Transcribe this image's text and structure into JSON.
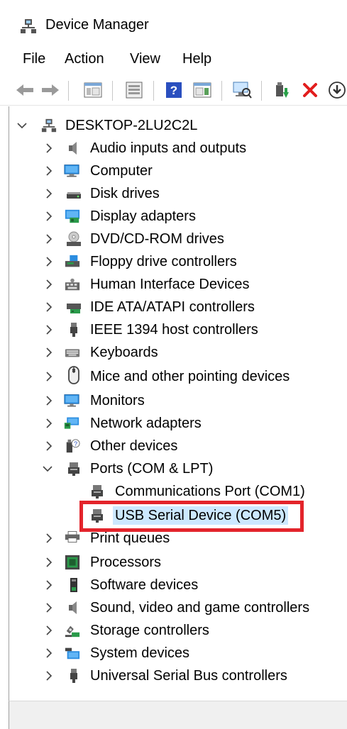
{
  "window": {
    "title": "Device Manager"
  },
  "menu": [
    "File",
    "Action",
    "View",
    "Help"
  ],
  "toolbar": {
    "buttons": [
      "back-arrow-icon",
      "forward-arrow-icon",
      "show-hide-console-tree-icon",
      "properties-icon",
      "help-icon",
      "action-pane-icon",
      "scan-hardware-icon",
      "update-driver-icon",
      "uninstall-icon",
      "download-icon"
    ]
  },
  "tree": {
    "root": "DESKTOP-2LU2C2L",
    "categories": [
      "Audio inputs and outputs",
      "Computer",
      "Disk drives",
      "Display adapters",
      "DVD/CD-ROM drives",
      "Floppy drive controllers",
      "Human Interface Devices",
      "IDE ATA/ATAPI controllers",
      "IEEE 1394 host controllers",
      "Keyboards",
      "Mice and other pointing devices",
      "Monitors",
      "Network adapters",
      "Other devices",
      "Ports (COM & LPT)",
      "Print queues",
      "Processors",
      "Software devices",
      "Sound, video and game controllers",
      "Storage controllers",
      "System devices",
      "Universal Serial Bus controllers"
    ],
    "ports_children": [
      "Communications Port (COM1)",
      "USB Serial Device (COM5)"
    ],
    "selected": "USB Serial Device (COM5)"
  },
  "colors": {
    "selection": "#cce8ff",
    "highlight": "#e3242b",
    "accent": "#0078d7"
  }
}
